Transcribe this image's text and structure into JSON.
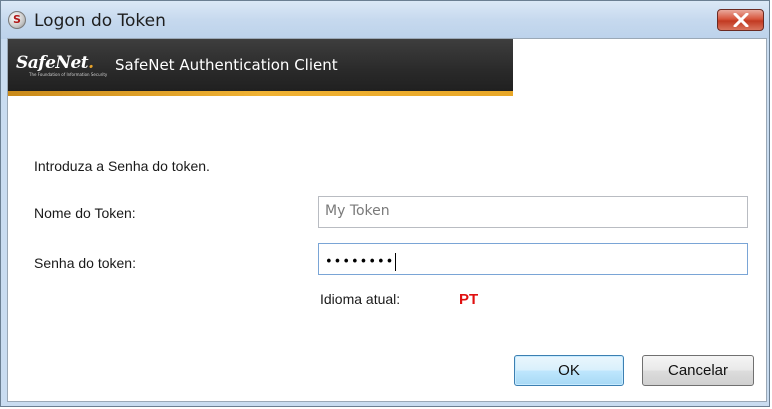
{
  "window": {
    "title": "Logon do Token",
    "app_icon_letter": "S"
  },
  "banner": {
    "logo_text": "SafeNet",
    "logo_dot": ".",
    "logo_tagline": "The Foundation of Information Security",
    "title": "SafeNet Authentication Client"
  },
  "form": {
    "instruction": "Introduza a Senha do token.",
    "token_name_label": "Nome do Token:",
    "token_name_value": "My Token",
    "password_label": "Senha do token:",
    "password_value": "••••••••",
    "language_label": "Idioma atual:",
    "language_value": "PT"
  },
  "buttons": {
    "ok": "OK",
    "cancel": "Cancelar"
  },
  "colors": {
    "banner_bg": "#2a2a2a",
    "banner_accent": "#f0b233",
    "language_value": "#e01010",
    "close_button": "#c23a22"
  }
}
